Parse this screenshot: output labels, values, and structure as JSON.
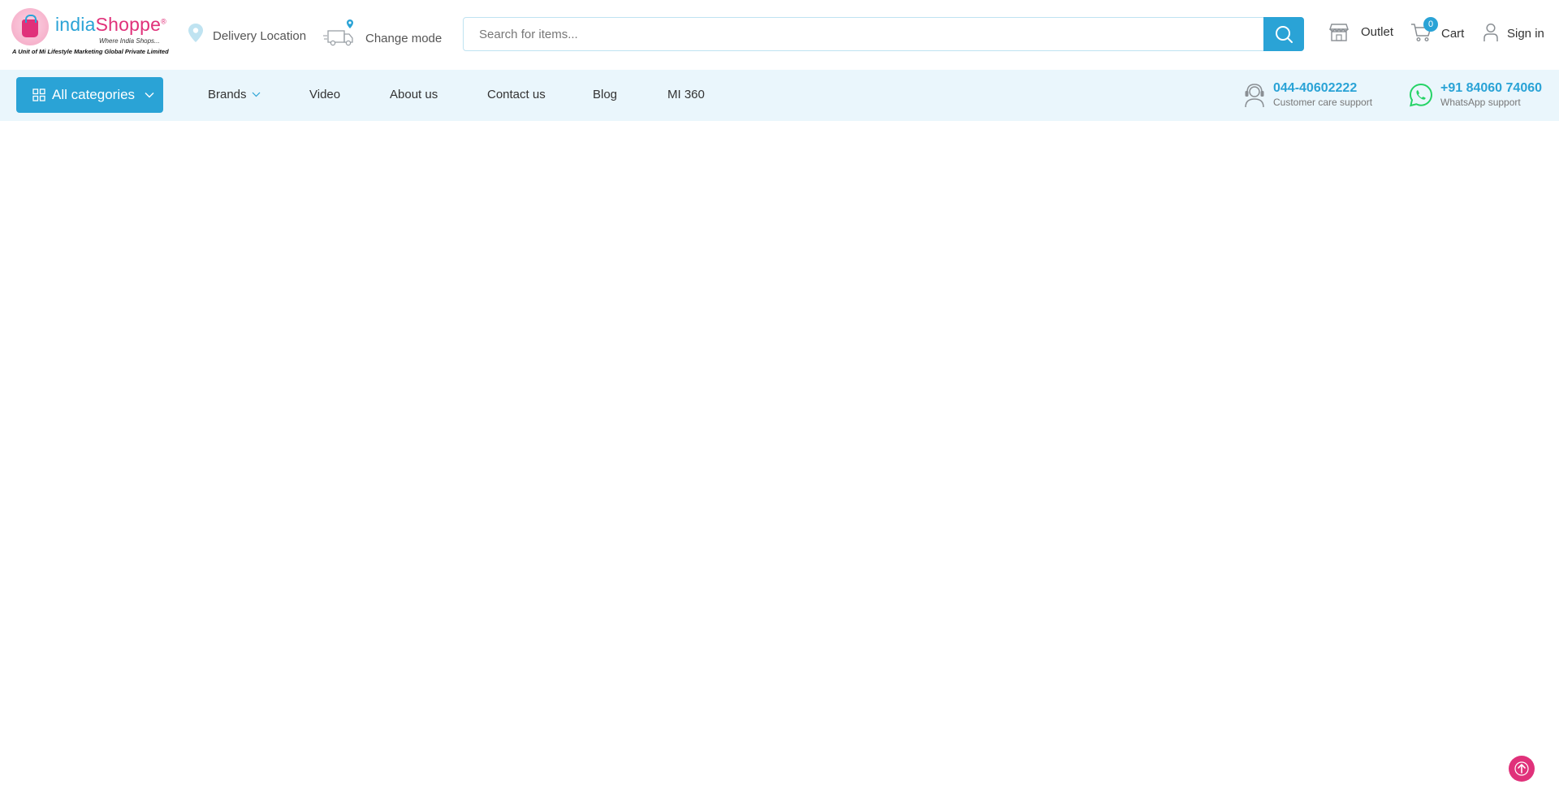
{
  "header": {
    "logo": {
      "name_part1": "india",
      "name_part2": "Shoppe",
      "registered": "®",
      "tagline": "Where India Shops...",
      "unit_text": "A Unit of Mi Lifestyle Marketing Global Private Limited"
    },
    "delivery_location_label": "Delivery Location",
    "change_mode_label": "Change mode",
    "search": {
      "placeholder": "Search for items...",
      "value": ""
    },
    "outlet_label": "Outlet",
    "cart": {
      "label": "Cart",
      "count": "0"
    },
    "signin_label": "Sign in"
  },
  "nav": {
    "all_categories_label": "All categories",
    "links": [
      {
        "label": "Brands"
      },
      {
        "label": "Video"
      },
      {
        "label": "About us"
      },
      {
        "label": "Contact us"
      },
      {
        "label": "Blog"
      },
      {
        "label": "MI 360"
      }
    ],
    "customer_support": {
      "number": "044-40602222",
      "label": "Customer care support"
    },
    "whatsapp_support": {
      "number": "+91 84060 74060",
      "label": "WhatsApp support"
    }
  },
  "colors": {
    "accent": "#2aa3d6",
    "brand_pink": "#e0317a",
    "nav_bg": "#eaf6fc",
    "whatsapp": "#25d366"
  },
  "icons": [
    "location-pin-icon",
    "delivery-truck-icon",
    "search-icon",
    "store-icon",
    "cart-icon",
    "user-icon",
    "grid-icon",
    "chevron-down-icon",
    "headset-icon",
    "whatsapp-icon",
    "arrow-up-icon"
  ]
}
